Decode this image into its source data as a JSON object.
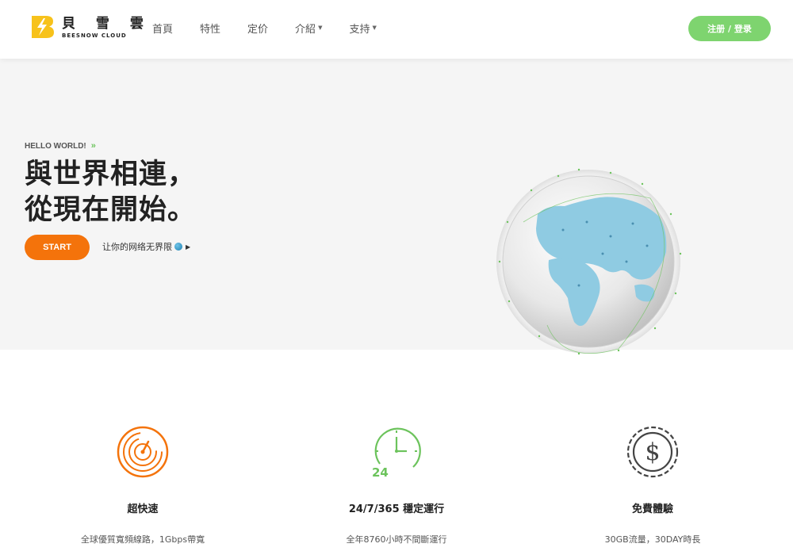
{
  "header": {
    "logo_cn": "貝 雪 雲",
    "logo_en": "BEESNOW CLOUD",
    "nav": [
      {
        "label": "首頁",
        "dropdown": false
      },
      {
        "label": "特性",
        "dropdown": false
      },
      {
        "label": "定价",
        "dropdown": false
      },
      {
        "label": "介紹",
        "dropdown": true
      },
      {
        "label": "支持",
        "dropdown": true
      }
    ],
    "cta_label": "注册 / 登录"
  },
  "hero": {
    "kicker": "HELLO WORLD!",
    "title_line1": "與世界相連，",
    "title_line2": "從現在開始。",
    "start_label": "START",
    "sub_link": "让你的网络无界限"
  },
  "features": [
    {
      "icon": "speedometer-icon",
      "title": "超快速",
      "desc": "全球優質寬頻線路，1Gbps帶寬",
      "color": "#f4730b"
    },
    {
      "icon": "clock-24-icon",
      "title": "24/7/365 穩定運行",
      "desc": "全年8760小時不間斷運行",
      "color": "#6cc35c"
    },
    {
      "icon": "dollar-coin-icon",
      "title": "免費體驗",
      "desc": "30GB流量，30DAY時長",
      "color": "#444444"
    }
  ],
  "colors": {
    "accent_green": "#7ed46f",
    "accent_orange": "#f4730b",
    "hero_bg": "#f5f5f5",
    "logo_yellow": "#f7c21b"
  }
}
